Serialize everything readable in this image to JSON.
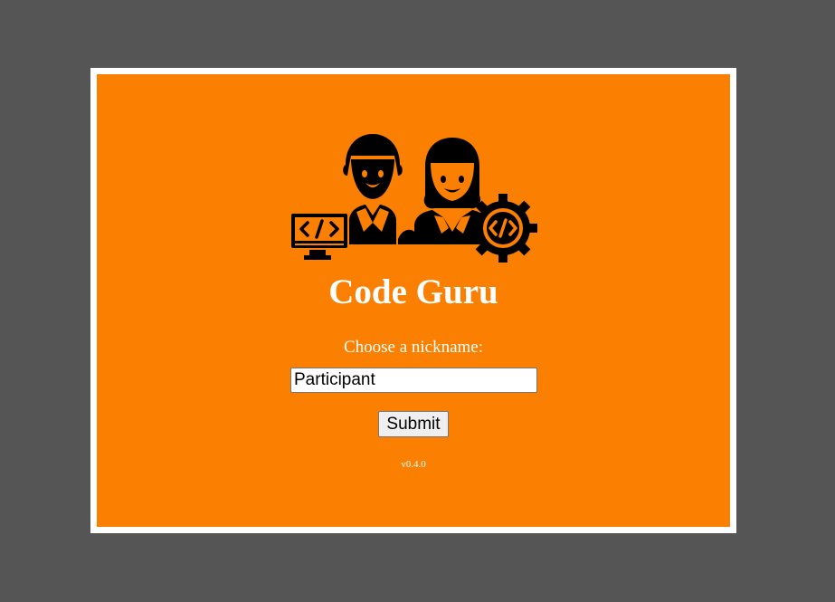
{
  "app": {
    "title": "Code Guru",
    "logo_icon": "developers-with-code-monitor-and-gear-icon"
  },
  "form": {
    "prompt_label": "Choose a nickname:",
    "nickname_value": "Participant",
    "submit_label": "Submit"
  },
  "footer": {
    "version": "v0.4.0"
  },
  "colors": {
    "background": "#555555",
    "frame": "#ffffff",
    "panel": "#fb7f00",
    "text": "#ffffff"
  }
}
